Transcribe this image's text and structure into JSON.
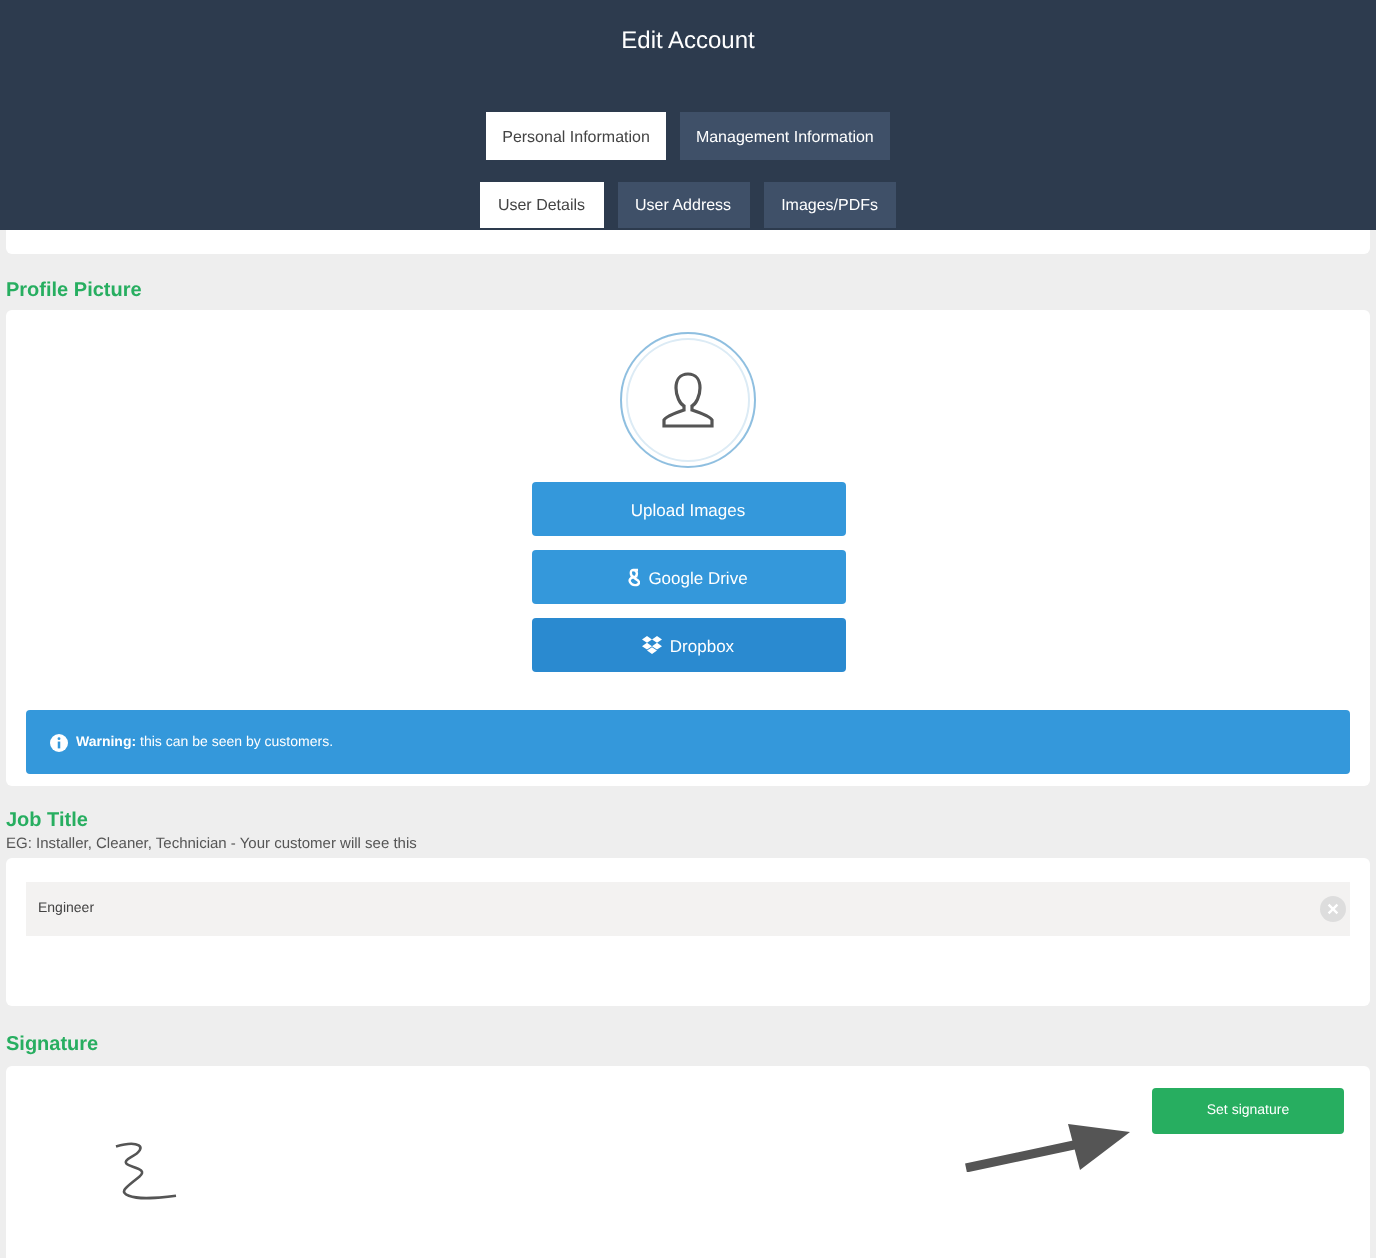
{
  "window": {
    "title": "Edit Account"
  },
  "tabs": [
    {
      "label": "Personal Information",
      "selected": true
    },
    {
      "label": "Management Information",
      "selected": false
    }
  ],
  "subtabs": [
    {
      "label": "User Details",
      "selected": true
    },
    {
      "label": "User Address",
      "selected": false
    },
    {
      "label": "Images/PDFs",
      "selected": false
    }
  ],
  "profile_picture": {
    "heading": "Profile Picture",
    "buttons": [
      {
        "label": "Upload Images",
        "kind": "upload"
      },
      {
        "label": "Google Drive",
        "kind": "google"
      },
      {
        "label": "Dropbox",
        "kind": "dropbox"
      }
    ],
    "warning": "**Warning:** this can be seen by customers."
  },
  "job_title": {
    "heading": "Job Title",
    "hint": "EG: Installer, Cleaner, Technician - Your customer will see this",
    "value": "Engineer"
  },
  "signature": {
    "heading": "Signature",
    "button": "Set signature"
  }
}
